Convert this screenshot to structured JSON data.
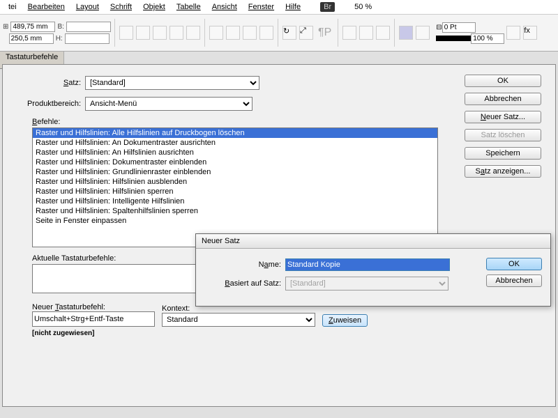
{
  "menubar": {
    "items": [
      "tei",
      "Bearbeiten",
      "Layout",
      "Schrift",
      "Objekt",
      "Tabelle",
      "Ansicht",
      "Fenster",
      "Hilfe"
    ],
    "br": "Br",
    "zoom": "50 %"
  },
  "toolbar": {
    "x": "489,75 mm",
    "y": "250,5 mm",
    "xl": "B:",
    "yl": "H:",
    "pt": "0 Pt",
    "pct": "100 %"
  },
  "tab": {
    "label": "Tastaturbefehle"
  },
  "dialog": {
    "set_label": "Satz:",
    "set_value": "[Standard]",
    "area_label": "Produktbereich:",
    "area_value": "Ansicht-Menü",
    "commands_label": "Befehle:",
    "commands": [
      "Raster und Hilfslinien: Alle Hilfslinien auf Druckbogen löschen",
      "Raster und Hilfslinien: An Dokumentraster ausrichten",
      "Raster und Hilfslinien: An Hilfslinien ausrichten",
      "Raster und Hilfslinien: Dokumentraster einblenden",
      "Raster und Hilfslinien: Grundlinienraster einblenden",
      "Raster und Hilfslinien: Hilfslinien ausblenden",
      "Raster und Hilfslinien: Hilfslinien sperren",
      "Raster und Hilfslinien: Intelligente Hilfslinien",
      "Raster und Hilfslinien: Spaltenhilfslinien sperren",
      "Seite in Fenster einpassen"
    ],
    "current_label": "Aktuelle Tastaturbefehle:",
    "new_shortcut_label": "Neuer Tastaturbefehl:",
    "new_shortcut_value": "Umschalt+Strg+Entf-Taste",
    "context_label": "Kontext:",
    "context_value": "Standard",
    "assign": "Zuweisen",
    "status": "[nicht zugewiesen]",
    "buttons": {
      "ok": "OK",
      "cancel": "Abbrechen",
      "new_set": "Neuer Satz...",
      "delete_set": "Satz löschen",
      "save": "Speichern",
      "show_set": "Satz anzeigen..."
    }
  },
  "modal": {
    "title": "Neuer Satz",
    "name_label": "Name:",
    "name_value": "Standard Kopie",
    "based_label": "Basiert auf Satz:",
    "based_value": "[Standard]",
    "ok": "OK",
    "cancel": "Abbrechen"
  }
}
